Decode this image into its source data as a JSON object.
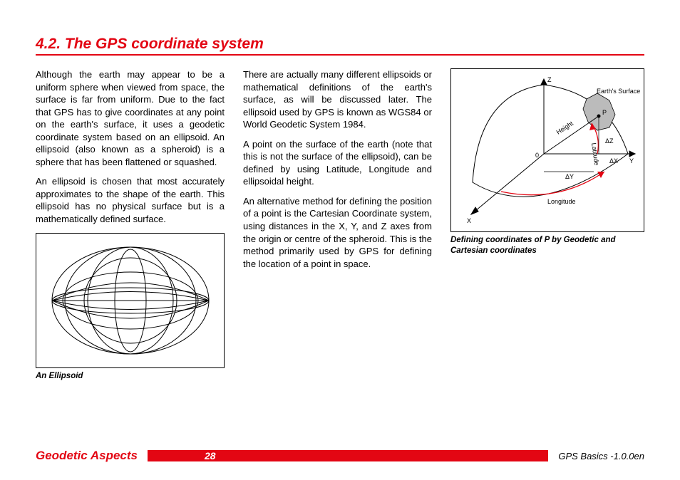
{
  "heading": "4.2. The GPS coordinate system",
  "col1": {
    "p1": "Although the earth may appear to be a uniform sphere when viewed from space, the surface is far from uniform. Due to the fact that GPS has to give coordinates at any point on the earth's surface, it uses a geodetic coordinate system based on an ellipsoid. An ellipsoid (also known as a spheroid) is a sphere that has been flattened or squashed.",
    "p2": "An ellipsoid is chosen that most accurately approximates to the shape of the earth. This ellipsoid has no physical surface but is a mathematically defined surface.",
    "caption": "An Ellipsoid"
  },
  "col2": {
    "p1": "There are actually many different ellipsoids or mathematical definitions of the earth's surface, as will be discussed later. The ellipsoid used by GPS is known as WGS84 or World Geodetic System 1984.",
    "p2": "A point on the surface of the earth (note that this is not the surface of the ellipsoid), can be defined by using Latitude, Longitude and ellipsoidal height.",
    "p3": "An alternative method for defining the position of a point is the Cartesian Coordinate system, using distances in the X, Y, and Z axes from the origin or centre of the spheroid. This is the method primarily used by GPS for defining the location of a point in space."
  },
  "col3": {
    "caption": "Defining coordinates of P by Geodetic and Cartesian coordinates",
    "labels": {
      "z": "Z",
      "y": "Y",
      "x": "X",
      "o": "0",
      "p": "P",
      "earth": "Earth's Surface",
      "height": "Height",
      "lat": "Latitude",
      "lon": "Longitude",
      "dz": "ΔZ",
      "dx": "ΔX",
      "dy": "ΔY"
    }
  },
  "footer": {
    "section": "Geodetic Aspects",
    "page": "28",
    "doc": "GPS Basics -1.0.0en"
  }
}
